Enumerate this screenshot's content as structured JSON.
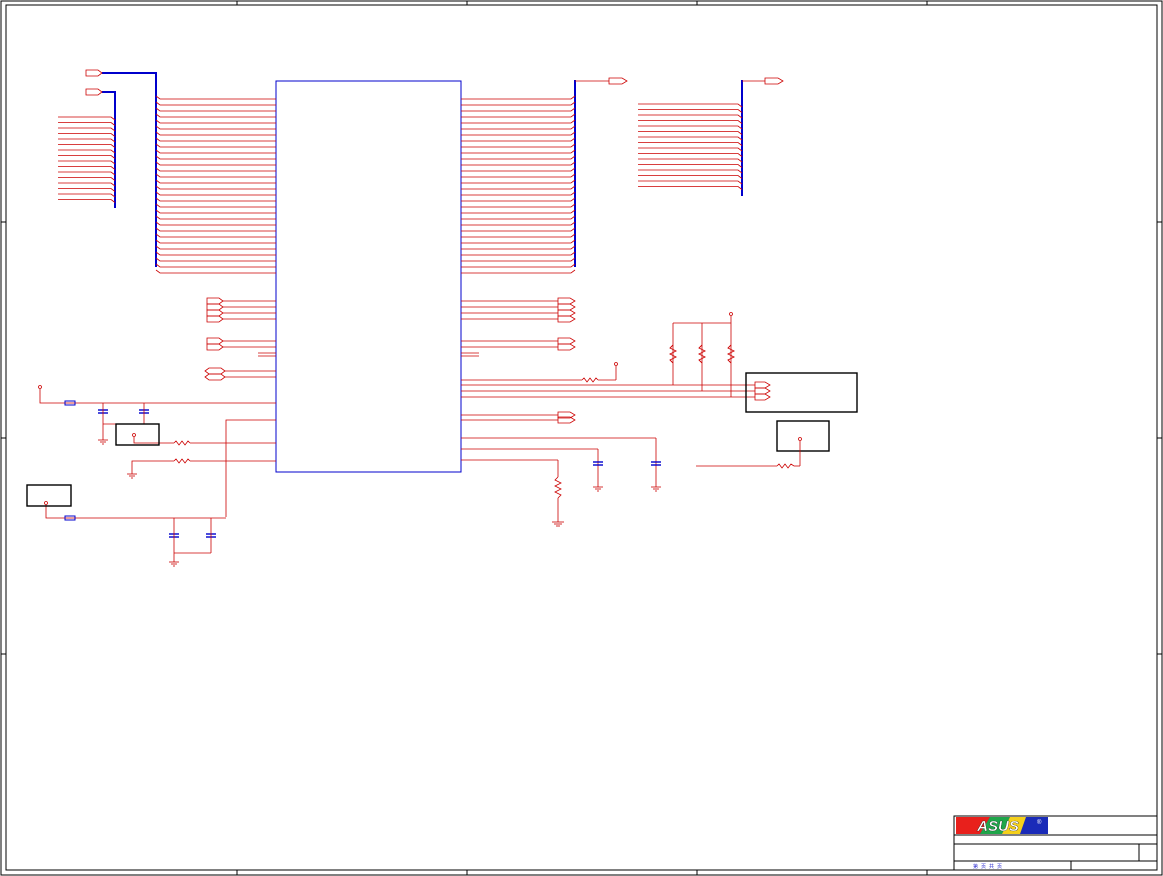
{
  "logo": {
    "text": "ASUS",
    "mark": "®"
  },
  "title_block": {
    "sheet_note": "第 页  共 页"
  },
  "colors": {
    "net": "#cc0000",
    "bus": "#0000cc",
    "outline": "#000000",
    "ic": "#0000cc",
    "logo_bg": "#1a2bb8"
  }
}
